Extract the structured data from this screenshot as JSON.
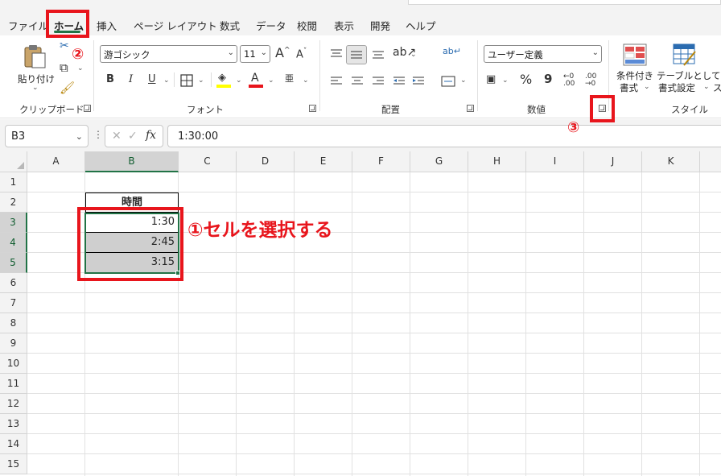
{
  "menu": {
    "tabs": [
      "ファイル",
      "ホーム",
      "挿入",
      "ページ レイアウト",
      "数式",
      "データ",
      "校閲",
      "表示",
      "開発",
      "ヘルプ"
    ],
    "active_tab": "ホーム"
  },
  "ribbon": {
    "clipboard": {
      "label": "クリップボード",
      "paste_label": "貼り付け",
      "paste_icon": "paste-icon",
      "cut_icon": "scissors-icon",
      "copy_icon": "copy-icon",
      "format_painter_icon": "brush-icon"
    },
    "font": {
      "label": "フォント",
      "font_name": "游ゴシック",
      "font_size": "11",
      "grow_icon": "A^",
      "shrink_icon": "Aˇ",
      "bold": "B",
      "italic": "I",
      "underline": "U",
      "border_icon": "border-icon",
      "fill_color": "#ffff00",
      "font_color": "#e8151c",
      "phonetic_icon": "亜"
    },
    "alignment": {
      "label": "配置"
    },
    "number": {
      "label": "数値",
      "format": "ユーザー定義",
      "percent": "%",
      "comma": "9"
    },
    "styles": {
      "label": "スタイル",
      "conditional_line1": "条件付き",
      "conditional_line2": "書式",
      "table_line1": "テーブルとして",
      "table_line2": "書式設定",
      "cell_styles_partial": "ス"
    }
  },
  "formula_bar": {
    "name_box": "B3",
    "fx": "fx",
    "value": "1:30:00"
  },
  "grid": {
    "columns": [
      "A",
      "B",
      "C",
      "D",
      "E",
      "F",
      "G",
      "H",
      "I",
      "J",
      "K"
    ],
    "rows": [
      "1",
      "2",
      "3",
      "4",
      "5",
      "6",
      "7",
      "8",
      "9",
      "10",
      "11",
      "12",
      "13",
      "14",
      "15"
    ],
    "selected_column": "B",
    "selected_rows": [
      "3",
      "4",
      "5"
    ],
    "header_cell": "時間",
    "values": [
      "1:30",
      "2:45",
      "3:15"
    ]
  },
  "annotations": {
    "step1": "①セルを選択する",
    "step2": "②",
    "step3": "③",
    "color": "#e8151c"
  }
}
